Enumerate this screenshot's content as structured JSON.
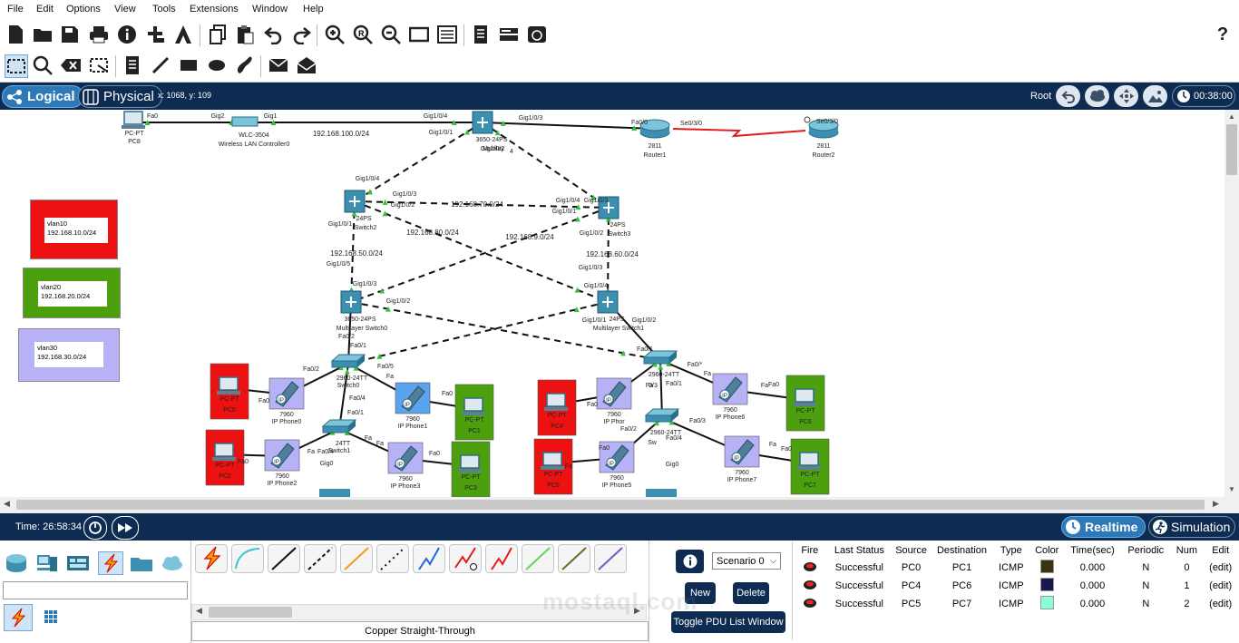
{
  "menu": [
    "File",
    "Edit",
    "Options",
    "View",
    "Tools",
    "Extensions",
    "Window",
    "Help"
  ],
  "mode_bar": {
    "logical_label": "Logical",
    "physical_label": "Physical",
    "coords": "x: 1068, y: 109",
    "root_label": "Root",
    "clock": "00:38:00"
  },
  "topology": {
    "devices": [
      {
        "id": "pc8",
        "name": "PC8",
        "model": "PC-PT",
        "type": "pc"
      },
      {
        "id": "wlc",
        "name": "Wireless LAN Controller0",
        "model": "WLC-3504",
        "type": "wlc"
      },
      {
        "id": "ml_top",
        "name": "Multilay",
        "model": "3650-24PS",
        "type": "l3switch"
      },
      {
        "id": "router1",
        "name": "Router1",
        "model": "2811",
        "type": "router"
      },
      {
        "id": "router2",
        "name": "Router2",
        "model": "2811",
        "type": "router"
      },
      {
        "id": "switch2",
        "name": "Switch2",
        "model": "24PS",
        "type": "l3switch"
      },
      {
        "id": "switch3",
        "name": "Switch3",
        "model": "24PS",
        "type": "l3switch"
      },
      {
        "id": "mlswitch0",
        "name": "Multilayer Switch0",
        "model": "3650-24PS",
        "type": "l3switch"
      },
      {
        "id": "mlswitch1",
        "name": "Multilayer Switch1",
        "model": "24PS",
        "type": "l3switch"
      },
      {
        "id": "switch0",
        "name": "Switch0",
        "model": "2960-24TT",
        "type": "switch"
      },
      {
        "id": "switch1",
        "name": "Switch1",
        "model": "24TT",
        "type": "switch"
      },
      {
        "id": "switch_r1",
        "name": "",
        "model": "2960-24TT",
        "type": "switch"
      },
      {
        "id": "switch_r2",
        "name": "",
        "model": "2960-24TT",
        "type": "switch"
      },
      {
        "id": "pc0",
        "name": "PC0",
        "model": "PC-PT",
        "type": "pc"
      },
      {
        "id": "pc1",
        "name": "PC1",
        "model": "PC-PT",
        "type": "pc"
      },
      {
        "id": "pc2",
        "name": "PC2",
        "model": "PC-PT",
        "type": "pc"
      },
      {
        "id": "pc3",
        "name": "PC3",
        "model": "PC-PT",
        "type": "pc"
      },
      {
        "id": "pc4",
        "name": "PC4",
        "model": "PC-PT",
        "type": "pc"
      },
      {
        "id": "pc5",
        "name": "PC5",
        "model": "PC-PT",
        "type": "pc"
      },
      {
        "id": "pc6",
        "name": "PC6",
        "model": "PC-PT",
        "type": "pc"
      },
      {
        "id": "pc7",
        "name": "PC7",
        "model": "PC-PT",
        "type": "pc"
      },
      {
        "id": "phone0",
        "name": "IP Phone0",
        "model": "7960",
        "type": "phone"
      },
      {
        "id": "phone1",
        "name": "IP Phone1",
        "model": "7960",
        "type": "phone"
      },
      {
        "id": "phone2",
        "name": "IP Phone2",
        "model": "7960",
        "type": "phone"
      },
      {
        "id": "phone3",
        "name": "IP Phone3",
        "model": "7960",
        "type": "phone"
      },
      {
        "id": "phone4",
        "name": "IP Phor",
        "model": "7960",
        "type": "phone"
      },
      {
        "id": "phone5",
        "name": "IP Phone5",
        "model": "7960",
        "type": "phone"
      },
      {
        "id": "phone6",
        "name": "IP Phone6",
        "model": "7960",
        "type": "phone"
      },
      {
        "id": "phone7",
        "name": "IP Phone7",
        "model": "7960",
        "type": "phone"
      }
    ],
    "vlan_notes": [
      {
        "id": "vlan10",
        "lines": [
          "vlan10",
          "192.168.10.0/24"
        ],
        "color": "#ee1111"
      },
      {
        "id": "vlan20",
        "lines": [
          "vlan20",
          "192.168.20.0/24"
        ],
        "color": "#4ca00e"
      },
      {
        "id": "vlan30",
        "lines": [
          "vlan30",
          "192.168.30.0/24"
        ],
        "color": "#b7b2f6"
      }
    ],
    "subnets": [
      "192.168.100.0/24",
      "192.168.70.0/24",
      "192.168.80.0/24",
      "192.168.9.0/24",
      "192.168.50.0/24",
      "192.168.60.0/24"
    ],
    "port_labels": [
      "Fa0",
      "Gig2",
      "Gig1",
      "Gig1/0/4",
      "Gig1/0/1",
      "Gig1/0/3",
      "Gig1/0/2",
      "Fa0/0",
      "Se0/3/0",
      "Gig1/0/5",
      "Gig0",
      "Fa0/1",
      "Fa0/2",
      "Fa0/3",
      "Fa0/4",
      "Fa0/5",
      "Fa",
      "4"
    ]
  },
  "time_bar": {
    "time_label": "Time: 26:58:34",
    "realtime_label": "Realtime",
    "simulation_label": "Simulation"
  },
  "device_panel": {
    "cable_name": "Copper Straight-Through",
    "cables": [
      "Automatic",
      "Console",
      "Copper Straight-Through",
      "Copper Cross-Over",
      "Fiber",
      "Phone",
      "Coaxial",
      "Serial DCE",
      "Serial DTE",
      "Octal",
      "IoT Custom Cable",
      "USB"
    ]
  },
  "scenario": {
    "selected": "Scenario 0",
    "new_label": "New",
    "delete_label": "Delete",
    "toggle_label": "Toggle PDU List Window"
  },
  "pdu_table": {
    "headers": [
      "Fire",
      "Last Status",
      "Source",
      "Destination",
      "Type",
      "Color",
      "Time(sec)",
      "Periodic",
      "Num",
      "Edit"
    ],
    "rows": [
      {
        "status": "Successful",
        "source": "PC0",
        "destination": "PC1",
        "type": "ICMP",
        "color": "#3a3210",
        "time": "0.000",
        "periodic": "N",
        "num": "0",
        "edit": "(edit)"
      },
      {
        "status": "Successful",
        "source": "PC4",
        "destination": "PC6",
        "type": "ICMP",
        "color": "#19194f",
        "time": "0.000",
        "periodic": "N",
        "num": "1",
        "edit": "(edit)"
      },
      {
        "status": "Successful",
        "source": "PC5",
        "destination": "PC7",
        "type": "ICMP",
        "color": "#8affd6",
        "time": "0.000",
        "periodic": "N",
        "num": "2",
        "edit": "(edit)"
      }
    ]
  },
  "watermark": {
    "text": "mostaql.com"
  }
}
